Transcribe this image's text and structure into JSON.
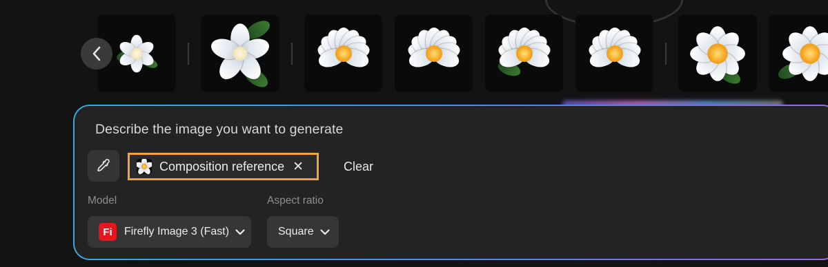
{
  "gallery": {
    "prev_icon": "chevron-left-icon"
  },
  "prompt": {
    "placeholder": "Describe the image you want to generate"
  },
  "reference": {
    "button_icon": "eyedropper-icon",
    "chip_label": "Composition reference",
    "chip_close": "✕",
    "clear_label": "Clear"
  },
  "settings": {
    "model_label": "Model",
    "model_value": "Firefly Image 3 (Fast)",
    "model_logo_text": "Fi",
    "aspect_label": "Aspect ratio",
    "aspect_value": "Square"
  },
  "colors": {
    "chip_border": "#f2a33a",
    "firefly_red": "#e5161f",
    "panel_border_start": "#3aa8d8",
    "panel_border_end": "#9a6fd8"
  }
}
